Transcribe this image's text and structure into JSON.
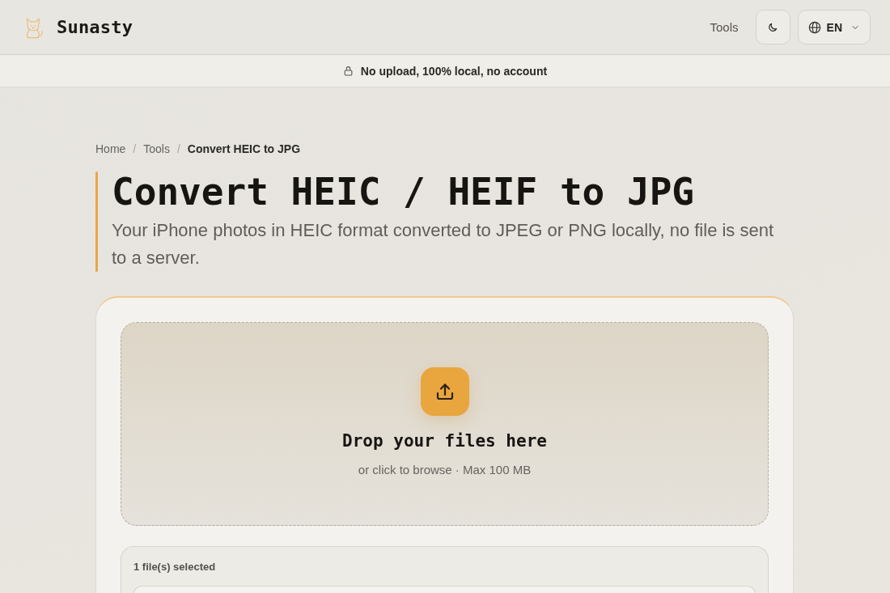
{
  "header": {
    "brand": "Sunasty",
    "nav": [
      {
        "label": "Tools"
      }
    ],
    "language": {
      "label": "EN"
    }
  },
  "banner": {
    "text": "No upload, 100% local, no account"
  },
  "breadcrumb": {
    "items": [
      {
        "label": "Home",
        "current": false
      },
      {
        "label": "Tools",
        "current": false
      },
      {
        "label": "Convert HEIC to JPG",
        "current": true
      }
    ],
    "separators": [
      "/",
      "/"
    ]
  },
  "hero": {
    "title": "Convert HEIC / HEIF to JPG",
    "description": "Your iPhone photos in HEIC format converted to JPEG or PNG locally, no file is sent to a server."
  },
  "dropzone": {
    "title": "Drop your files here",
    "hint": "or click to browse · Max 100 MB"
  },
  "selection": {
    "summary": "1 file(s) selected"
  }
}
